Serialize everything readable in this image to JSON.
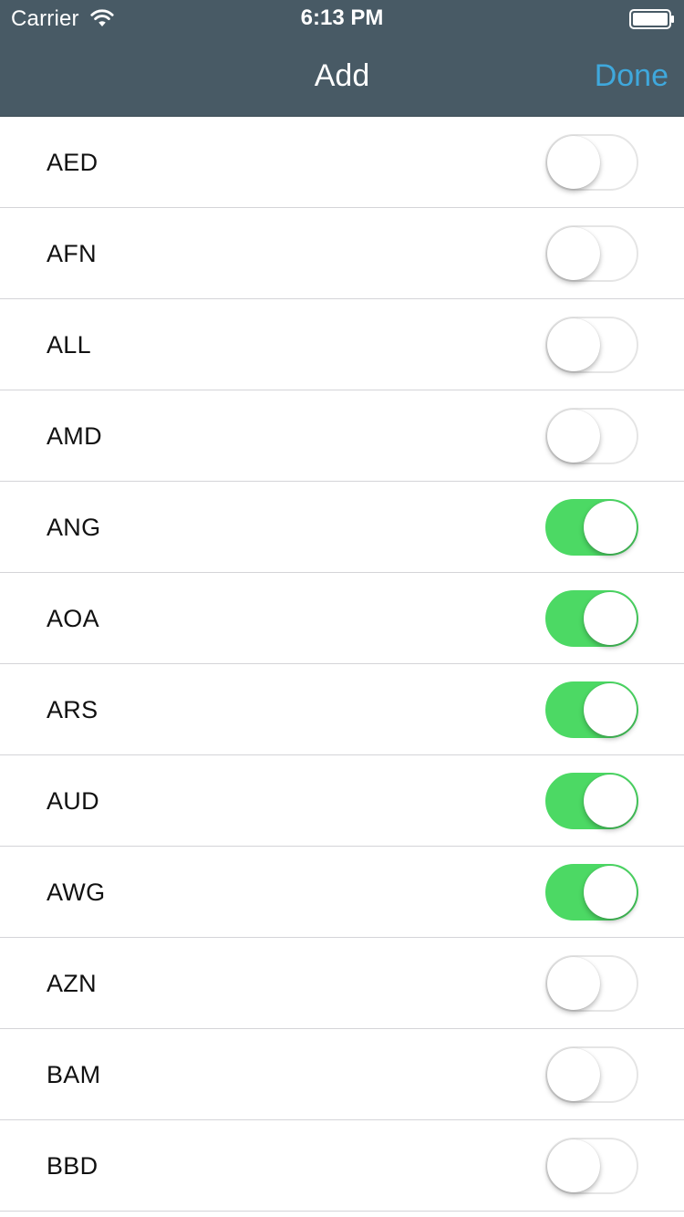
{
  "status_bar": {
    "carrier": "Carrier",
    "time": "6:13 PM",
    "wifi_icon": "wifi-icon",
    "battery_icon": "battery-icon"
  },
  "nav": {
    "title": "Add",
    "done_label": "Done"
  },
  "colors": {
    "nav_background": "#485a65",
    "accent": "#3fa8dc",
    "switch_on": "#4cd964",
    "separator": "#d4d4d8"
  },
  "currencies": [
    {
      "code": "AED",
      "enabled": false
    },
    {
      "code": "AFN",
      "enabled": false
    },
    {
      "code": "ALL",
      "enabled": false
    },
    {
      "code": "AMD",
      "enabled": false
    },
    {
      "code": "ANG",
      "enabled": true
    },
    {
      "code": "AOA",
      "enabled": true
    },
    {
      "code": "ARS",
      "enabled": true
    },
    {
      "code": "AUD",
      "enabled": true
    },
    {
      "code": "AWG",
      "enabled": true
    },
    {
      "code": "AZN",
      "enabled": false
    },
    {
      "code": "BAM",
      "enabled": false
    },
    {
      "code": "BBD",
      "enabled": false
    }
  ]
}
